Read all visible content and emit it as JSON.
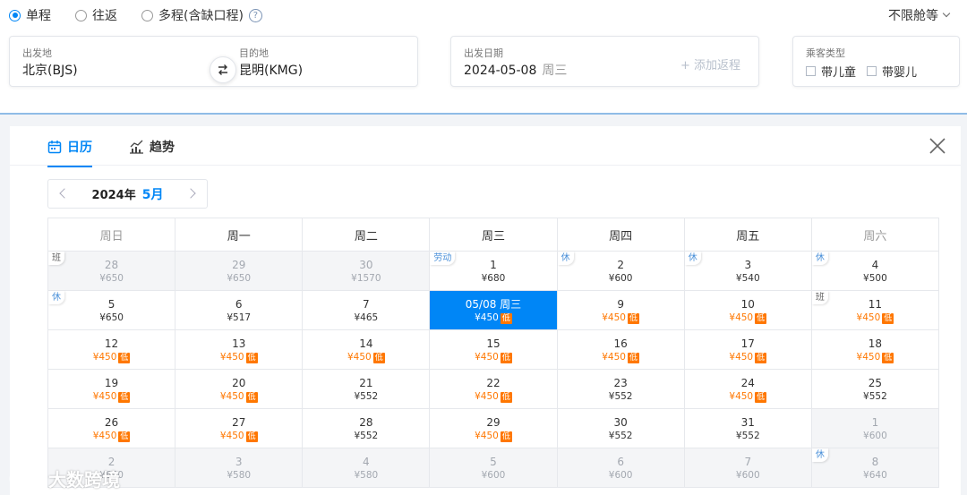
{
  "trip": {
    "oneway": "单程",
    "roundtrip": "往返",
    "multi": "多程(含缺口程)",
    "help": "?",
    "cabin": "不限舱等"
  },
  "search": {
    "from_label": "出发地",
    "from_value": "北京(BJS)",
    "to_label": "目的地",
    "to_value": "昆明(KMG)",
    "swap": "⇄",
    "date_label": "出发日期",
    "date_value": "2024-05-08",
    "date_weekday": "周三",
    "add_return": "+ 添加返程",
    "pax_label": "乘客类型",
    "child": "带儿童",
    "infant": "带婴儿"
  },
  "tabs": {
    "calendar": "日历",
    "trend": "趋势"
  },
  "month_nav": {
    "year": "2024年",
    "month": "5月"
  },
  "weekdays": [
    "周日",
    "周一",
    "周二",
    "周三",
    "周四",
    "周五",
    "周六"
  ],
  "low_tag": "低",
  "weeks": [
    [
      {
        "d": "28",
        "p": "¥650",
        "other": true,
        "badge": "班"
      },
      {
        "d": "29",
        "p": "¥650",
        "other": true
      },
      {
        "d": "30",
        "p": "¥1570",
        "other": true
      },
      {
        "d": "1",
        "p": "¥680",
        "badge": "劳动"
      },
      {
        "d": "2",
        "p": "¥600",
        "badge": "休"
      },
      {
        "d": "3",
        "p": "¥540",
        "badge": "休"
      },
      {
        "d": "4",
        "p": "¥500",
        "badge": "休"
      }
    ],
    [
      {
        "d": "5",
        "p": "¥650",
        "badge": "休"
      },
      {
        "d": "6",
        "p": "¥517"
      },
      {
        "d": "7",
        "p": "¥465"
      },
      {
        "d": "05/08 周三",
        "p": "¥450",
        "low": true,
        "selected": true
      },
      {
        "d": "9",
        "p": "¥450",
        "low": true
      },
      {
        "d": "10",
        "p": "¥450",
        "low": true
      },
      {
        "d": "11",
        "p": "¥450",
        "low": true,
        "badge": "班"
      }
    ],
    [
      {
        "d": "12",
        "p": "¥450",
        "low": true
      },
      {
        "d": "13",
        "p": "¥450",
        "low": true
      },
      {
        "d": "14",
        "p": "¥450",
        "low": true
      },
      {
        "d": "15",
        "p": "¥450",
        "low": true
      },
      {
        "d": "16",
        "p": "¥450",
        "low": true
      },
      {
        "d": "17",
        "p": "¥450",
        "low": true
      },
      {
        "d": "18",
        "p": "¥450",
        "low": true
      }
    ],
    [
      {
        "d": "19",
        "p": "¥450",
        "low": true
      },
      {
        "d": "20",
        "p": "¥450",
        "low": true
      },
      {
        "d": "21",
        "p": "¥552"
      },
      {
        "d": "22",
        "p": "¥450",
        "low": true
      },
      {
        "d": "23",
        "p": "¥552"
      },
      {
        "d": "24",
        "p": "¥450",
        "low": true
      },
      {
        "d": "25",
        "p": "¥552"
      }
    ],
    [
      {
        "d": "26",
        "p": "¥450",
        "low": true
      },
      {
        "d": "27",
        "p": "¥450",
        "low": true
      },
      {
        "d": "28",
        "p": "¥552"
      },
      {
        "d": "29",
        "p": "¥450",
        "low": true
      },
      {
        "d": "30",
        "p": "¥552"
      },
      {
        "d": "31",
        "p": "¥552"
      },
      {
        "d": "1",
        "p": "¥600",
        "other": true
      }
    ],
    [
      {
        "d": "2",
        "p": "¥600",
        "other": true
      },
      {
        "d": "3",
        "p": "¥580",
        "other": true
      },
      {
        "d": "4",
        "p": "¥580",
        "other": true
      },
      {
        "d": "5",
        "p": "¥600",
        "other": true
      },
      {
        "d": "6",
        "p": "¥600",
        "other": true
      },
      {
        "d": "7",
        "p": "¥600",
        "other": true
      },
      {
        "d": "8",
        "p": "¥640",
        "other": true,
        "badge": "休"
      }
    ]
  ],
  "watermark": "大数跨境"
}
